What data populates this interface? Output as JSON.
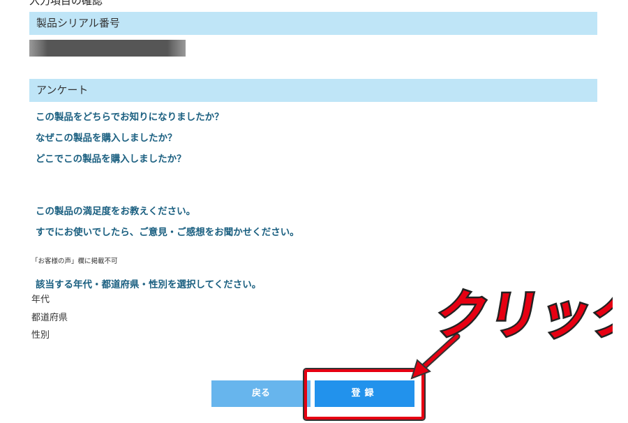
{
  "top_section_title": "入力項目の確認",
  "serial": {
    "header": "製品シリアル番号"
  },
  "survey": {
    "header": "アンケート",
    "questions": [
      "この製品をどちらでお知りになりましたか？",
      "なぜこの製品を購入しましたか？",
      "どこでこの製品を購入しましたか？",
      "この製品の満足度をお教えください。",
      "すでにお使いでしたら、ご意見・ご感想をお聞かせください。"
    ],
    "voice_note": "「お客様の声」欄に掲載不可",
    "demographics_prompt": "該当する年代・都道府県・性別を選択してください。",
    "fields": [
      "年代",
      "都道府県",
      "性別"
    ]
  },
  "buttons": {
    "back": "戻る",
    "register": "登録"
  },
  "annotation": {
    "callout_text": "クリック",
    "highlight_color": "#e60012"
  },
  "colors": {
    "section_header_bg": "#bfe5f7",
    "question_text": "#1a5f80",
    "back_button": "#67b5ed",
    "register_button": "#2292ec"
  }
}
